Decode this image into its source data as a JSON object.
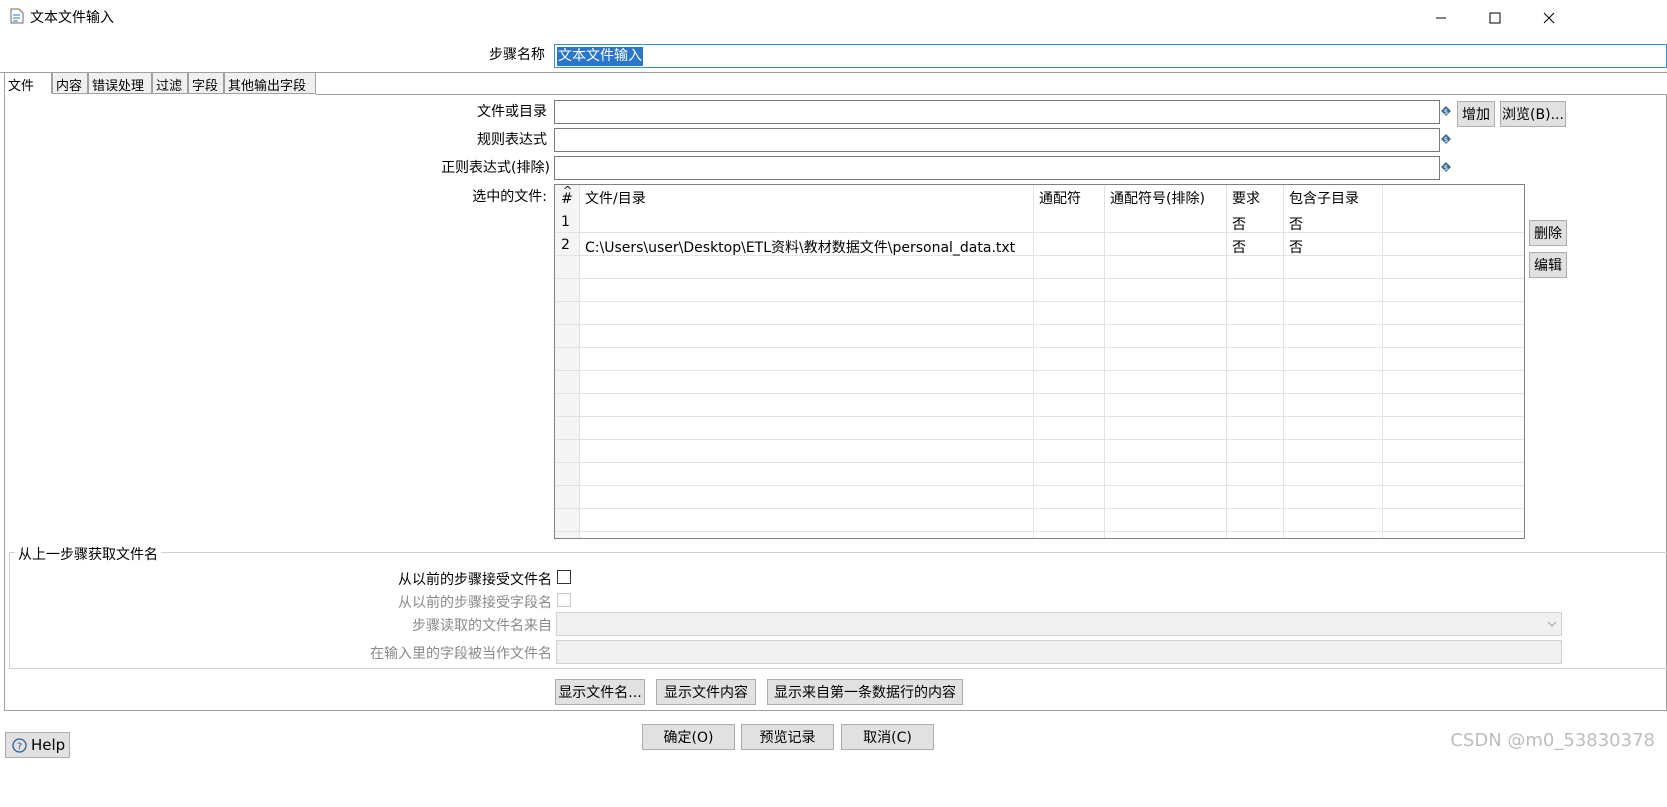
{
  "window": {
    "title": "文本文件输入",
    "controls": {
      "minimize": "—",
      "maximize": "☐",
      "close": "✕"
    }
  },
  "step": {
    "label": "步骤名称",
    "value": "文本文件输入"
  },
  "tabs": [
    {
      "label": "文件",
      "active": true
    },
    {
      "label": "内容"
    },
    {
      "label": "错误处理"
    },
    {
      "label": "过滤"
    },
    {
      "label": "字段"
    },
    {
      "label": "其他输出字段"
    }
  ],
  "file_tab": {
    "file_or_dir_label": "文件或目录",
    "regex_label": "规则表达式",
    "regex_exclude_label": "正则表达式(排除)",
    "selected_files_label": "选中的文件:",
    "add_button": "增加",
    "browse_button": "浏览(B)...",
    "delete_button": "删除",
    "edit_button": "编辑",
    "table": {
      "sort_indicator": "^",
      "columns": [
        "#",
        "文件/目录",
        "通配符",
        "通配符号(排除)",
        "要求",
        "包含子目录"
      ],
      "rows": [
        {
          "num": "1",
          "path": "",
          "wildcard": "",
          "wildcard_exclude": "",
          "required": "否",
          "include_sub": "否"
        },
        {
          "num": "2",
          "path": "C:\\Users\\user\\Desktop\\ETL资料\\教材数据文件\\personal_data.txt",
          "wildcard": "",
          "wildcard_exclude": "",
          "required": "否",
          "include_sub": "否"
        }
      ]
    }
  },
  "prev_step_group": {
    "title": "从上一步骤获取文件名",
    "accept_filenames_label": "从以前的步骤接受文件名",
    "accept_fieldname_label": "从以前的步骤接受字段名",
    "step_source_label": "步骤读取的文件名来自",
    "field_as_filename_label": "在输入里的字段被当作文件名"
  },
  "show_buttons": {
    "show_filenames": "显示文件名...",
    "show_file_content": "显示文件内容",
    "show_first_row": "显示来自第一条数据行的内容"
  },
  "footer": {
    "ok": "确定(O)",
    "preview": "预览记录",
    "cancel": "取消(C)",
    "help": "Help"
  },
  "watermark": "CSDN @m0_53830378"
}
